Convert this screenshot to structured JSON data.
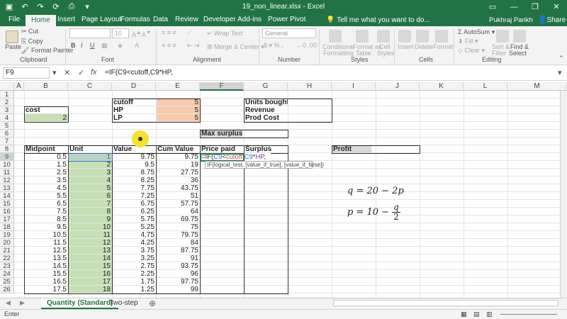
{
  "window": {
    "title": "19_non_linear.xlsx - Excel",
    "user": "Pukhraj Parikh",
    "share": "Share",
    "tell_me": "Tell me what you want to do..."
  },
  "tabs": [
    "File",
    "Home",
    "Insert",
    "Page Layout",
    "Formulas",
    "Data",
    "Review",
    "Developer",
    "Add-ins",
    "Power Pivot"
  ],
  "active_tab": "Home",
  "ribbon": {
    "clipboard": {
      "paste": "Paste",
      "cut": "Cut",
      "copy": "Copy",
      "format_painter": "Format Painter",
      "label": "Clipboard"
    },
    "font": {
      "size": "10",
      "label": "Font",
      "bold": "B",
      "italic": "I",
      "underline": "U"
    },
    "alignment": {
      "wrap": "Wrap Text",
      "merge": "Merge & Center",
      "label": "Alignment"
    },
    "number": {
      "format": "General",
      "label": "Number"
    },
    "styles": {
      "conditional": "Conditional",
      "conditional2": "Formatting",
      "table": "Format as",
      "table2": "Table",
      "cell": "Cell",
      "cell2": "Styles",
      "label": "Styles"
    },
    "cells": {
      "insert": "Insert",
      "delete": "Delete",
      "format": "Format",
      "label": "Cells"
    },
    "editing": {
      "autosum": "AutoSum",
      "fill": "Fill",
      "clear": "Clear",
      "sort": "Sort &",
      "sort2": "Filter",
      "find": "Find &",
      "find2": "Select",
      "label": "Editing"
    }
  },
  "formula_bar": {
    "name_box": "F9",
    "formula": "=IF(C9<cutoff,C9*HP,"
  },
  "columns": [
    "A",
    "B",
    "C",
    "D",
    "E",
    "F",
    "G",
    "H",
    "I",
    "J",
    "K",
    "L",
    "M"
  ],
  "rows": [
    "1",
    "2",
    "3",
    "4",
    "5",
    "6",
    "7",
    "8",
    "9",
    "10",
    "11",
    "12",
    "13",
    "14",
    "15",
    "16",
    "17",
    "18",
    "19",
    "20",
    "21",
    "22",
    "23",
    "24",
    "25",
    "26"
  ],
  "sheet": {
    "cost_label": "cost",
    "cost_value": "2",
    "params": [
      {
        "label": "cutoff",
        "value": "5"
      },
      {
        "label": "HP",
        "value": "5"
      },
      {
        "label": "LP",
        "value": "5"
      }
    ],
    "summary": [
      "Units bought",
      "Revenue",
      "Prod Cost"
    ],
    "max_surplus": "Max surplus",
    "profit": "Profit",
    "headers": [
      "Midpoint",
      "Unit",
      "Value",
      "Cum Value",
      "Price paid",
      "Surplus"
    ],
    "data": [
      [
        "0.5",
        "1",
        "9.75",
        "9.75"
      ],
      [
        "1.5",
        "2",
        "9.5",
        "19"
      ],
      [
        "2.5",
        "3",
        "8.75",
        "27.75"
      ],
      [
        "3.5",
        "4",
        "8.25",
        "36"
      ],
      [
        "4.5",
        "5",
        "7.75",
        "43.75"
      ],
      [
        "5.5",
        "6",
        "7.25",
        "51"
      ],
      [
        "6.5",
        "7",
        "6.75",
        "57.75"
      ],
      [
        "7.5",
        "8",
        "6.25",
        "64"
      ],
      [
        "8.5",
        "9",
        "5.75",
        "69.75"
      ],
      [
        "9.5",
        "10",
        "5.25",
        "75"
      ],
      [
        "10.5",
        "11",
        "4.75",
        "79.75"
      ],
      [
        "11.5",
        "12",
        "4.25",
        "84"
      ],
      [
        "12.5",
        "13",
        "3.75",
        "87.75"
      ],
      [
        "13.5",
        "14",
        "3.25",
        "91"
      ],
      [
        "14.5",
        "15",
        "2.75",
        "93.75"
      ],
      [
        "15.5",
        "16",
        "2.25",
        "96"
      ],
      [
        "16.5",
        "17",
        "1.75",
        "97.75"
      ],
      [
        "17.5",
        "18",
        "1.25",
        "99"
      ]
    ],
    "editing_cell_text": "=IF(C9<cutoff,C9*HP,",
    "tooltip": "IF(logical_test, [value_if_true], [value_if_false])",
    "eq1": "q = 20 − 2p",
    "eq2_lhs": "p = 10 −",
    "eq2_num": "q",
    "eq2_den": "2"
  },
  "sheet_tabs": [
    "Quantity (Standard)",
    "Two-step"
  ],
  "active_sheet": "Quantity (Standard)",
  "status": {
    "mode": "Enter"
  },
  "colors": {
    "accent": "#217346",
    "green_fill": "#c6e0b4",
    "pink_fill": "#f8cbad"
  }
}
